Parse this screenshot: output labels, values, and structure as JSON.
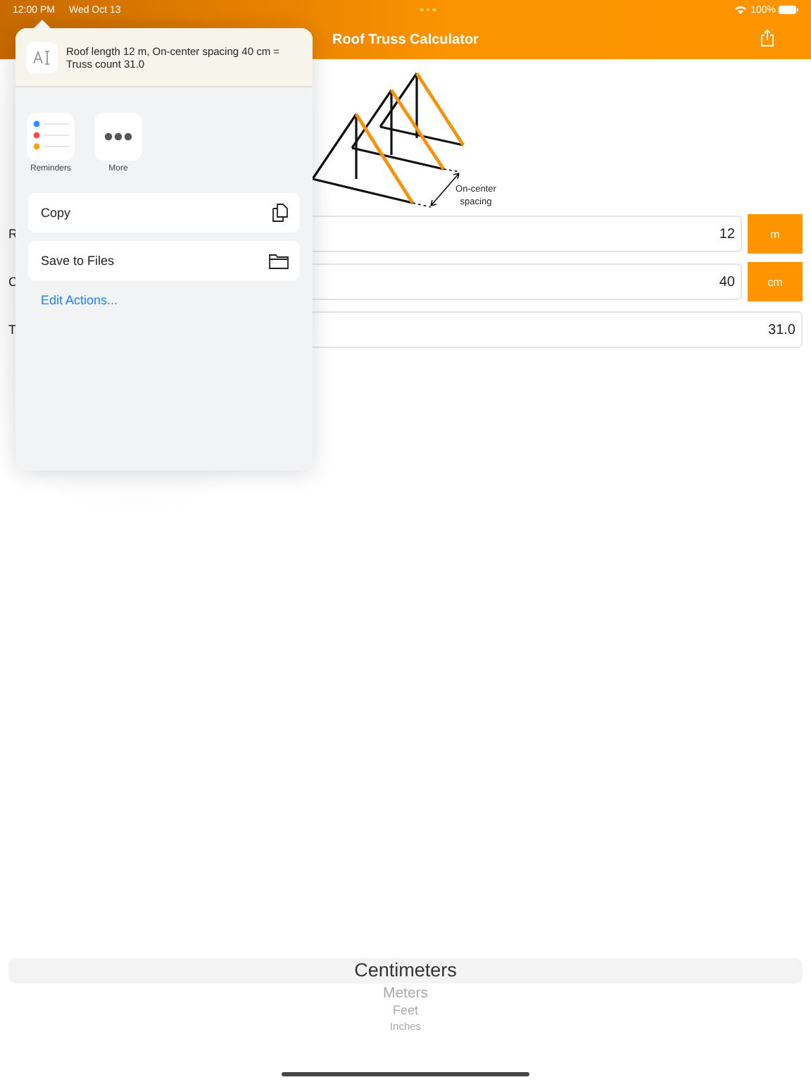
{
  "status_bar": {
    "time": "12:00 PM",
    "date": "Wed Oct 13",
    "battery": "100%"
  },
  "nav": {
    "title": "Roof Truss Calculator"
  },
  "diagram": {
    "caption": [
      "On-center",
      "spacing"
    ]
  },
  "form": [
    {
      "label": "R",
      "value": "12",
      "unit": "m"
    },
    {
      "label": "C",
      "value": "40",
      "unit": "cm"
    },
    {
      "label": "T",
      "value": "31.0"
    }
  ],
  "share_sheet": {
    "preview_text": "Roof length 12 m, On-center spacing 40 cm = Truss count 31.0",
    "apps": [
      {
        "kind": "reminders",
        "label": "Reminders"
      },
      {
        "kind": "more",
        "label": "More"
      }
    ],
    "actions": [
      {
        "kind": "copy",
        "label": "Copy"
      },
      {
        "kind": "files",
        "label": "Save to Files"
      }
    ],
    "edit_link": "Edit Actions..."
  },
  "picker": {
    "items": [
      {
        "label": "Centimeters",
        "selected": true
      },
      {
        "label": "Meters",
        "selected": false
      },
      {
        "label": "Feet",
        "selected": false
      },
      {
        "label": "Inches",
        "selected": false
      }
    ]
  }
}
